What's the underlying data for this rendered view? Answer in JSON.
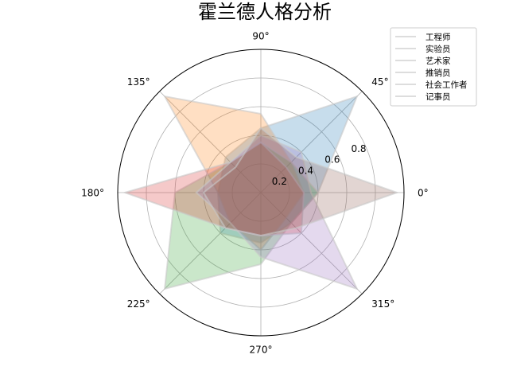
{
  "chart_data": {
    "type": "radar",
    "title": "霍兰德人格分析",
    "angle_unit": "°",
    "angles": [
      0,
      45,
      90,
      135,
      180,
      225,
      270,
      315
    ],
    "angle_labels": [
      "0",
      "45",
      "90",
      "135",
      "180",
      "225",
      "270",
      "315"
    ],
    "rlim": [
      0,
      1.0
    ],
    "radial_ticks": [
      0.2,
      0.4,
      0.6,
      0.8,
      1.0
    ],
    "radial_tick_labels": [
      "0.2",
      "0.4",
      "0.6",
      "0.8",
      ""
    ],
    "grid": true,
    "legend_placement": "top-right",
    "series": [
      {
        "name": "工程师",
        "color": "#1f77b4",
        "values": [
          0.4,
          0.95,
          0.45,
          0.35,
          0.3,
          0.4,
          0.35,
          0.3
        ]
      },
      {
        "name": "实验员",
        "color": "#ff7f0e",
        "values": [
          0.3,
          0.3,
          0.55,
          0.95,
          0.3,
          0.3,
          0.4,
          0.25
        ]
      },
      {
        "name": "艺术家",
        "color": "#2ca02c",
        "values": [
          0.4,
          0.3,
          0.35,
          0.3,
          0.6,
          0.95,
          0.5,
          0.3
        ]
      },
      {
        "name": "推销员",
        "color": "#d62728",
        "values": [
          0.3,
          0.25,
          0.35,
          0.3,
          0.95,
          0.35,
          0.3,
          0.4
        ]
      },
      {
        "name": "社会工作者",
        "color": "#9467bd",
        "values": [
          0.35,
          0.4,
          0.4,
          0.3,
          0.45,
          0.3,
          0.45,
          0.95
        ]
      },
      {
        "name": "记事员",
        "color": "#8c564b",
        "values": [
          0.95,
          0.35,
          0.45,
          0.25,
          0.4,
          0.35,
          0.3,
          0.35
        ]
      }
    ]
  }
}
